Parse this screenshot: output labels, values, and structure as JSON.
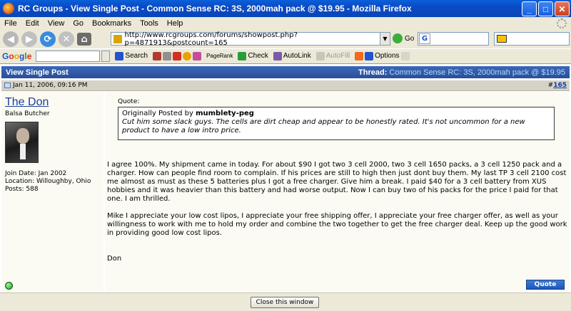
{
  "window": {
    "title": "RC Groups - View Single Post - Common Sense RC: 3S, 2000mah pack @ $19.95 - Mozilla Firefox",
    "buttons": {
      "minimize": "_",
      "maximize": "□",
      "close": "✕"
    }
  },
  "menu": [
    "File",
    "Edit",
    "View",
    "Go",
    "Bookmarks",
    "Tools",
    "Help"
  ],
  "nav": {
    "url": "http://www.rcgroups.com/forums/showpost.php?p=4871913&postcount=165",
    "go_label": "Go"
  },
  "google_toolbar": {
    "logo": [
      "G",
      "o",
      "o",
      "g",
      "l",
      "e"
    ],
    "items": {
      "search": "Search",
      "pagerank": "PageRank",
      "check": "Check",
      "autolink": "AutoLink",
      "autofill": "AutoFill",
      "options": "Options"
    }
  },
  "header": {
    "left": "View Single Post",
    "thread_label": "Thread:",
    "thread_title": "Common Sense RC: 3S, 2000mah pack @ $19.95"
  },
  "post": {
    "date": "Jan 11, 2006, 09:16 PM",
    "number_prefix": "#",
    "number": "165",
    "user": {
      "name": "The Don",
      "title": "Balsa Butcher",
      "join_date": "Join Date: Jan 2002",
      "location": "Location: Willoughby, Ohio",
      "posts": "Posts: 588"
    },
    "quote": {
      "label": "Quote:",
      "posted_by_prefix": "Originally Posted by",
      "author": "mumblety-peg",
      "text": "Cut him some slack guys. The cells are dirt cheap and appear to be honestly rated. It's not uncommon for a new product to have a low intro price."
    },
    "paragraphs": [
      "I agree 100%. My shipment came in today. For about $90 I got two 3 cell 2000, two 3 cell 1650 packs, a 3 cell 1250 pack and a charger. How can people find room to complain. If his prices are still to high then just dont buy them. My last TP 3 cell 2100 cost me almost as must as these 5 batteries plus I got a free charger. Give him a break. I paid $40 for a 3 cell battery from XUS hobbies and it was heavier than this battery and had worse output. Now I can buy two of his packs for the price I paid for that one. I am thrilled.",
      "Mike I appreciate your low cost lipos, I appreciate your free shipping offer, I appreciate your free charger offer, as well as your willingness to work with me to hold my order and combine the two together to get the free charger deal. Keep up the good work in providing good low cost lipos.",
      "Don"
    ],
    "quote_button": "Quote"
  },
  "footer": {
    "close_button": "Close this window"
  }
}
